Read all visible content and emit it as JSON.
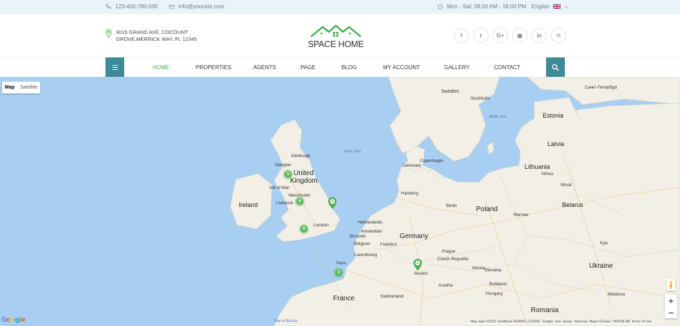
{
  "topbar": {
    "phone": "123-456-789-000",
    "email": "info@yoursite.com",
    "hours": "Mon - Sat: 08.00 AM - 18.00 PM",
    "language": "English"
  },
  "header": {
    "address_line1": "3015 GRAND AVE, COCOUNT",
    "address_line2": "GROVE,MERRICK WAY, FL 12345",
    "logo_text": "SPACE HOME",
    "socials": [
      {
        "icon": "facebook-icon",
        "glyph": "f"
      },
      {
        "icon": "twitter-icon",
        "glyph": "t"
      },
      {
        "icon": "google-plus-icon",
        "glyph": "G+"
      },
      {
        "icon": "flickr-icon",
        "glyph": "▣"
      },
      {
        "icon": "linkedin-icon",
        "glyph": "in"
      },
      {
        "icon": "pinterest-icon",
        "glyph": "℗"
      }
    ]
  },
  "nav": {
    "items": [
      {
        "label": "HOME",
        "active": true
      },
      {
        "label": "PROPERTIES",
        "active": false
      },
      {
        "label": "AGENTS",
        "active": false
      },
      {
        "label": "PAGE",
        "active": false
      },
      {
        "label": "BLOG",
        "active": false
      },
      {
        "label": "MY ACCOUNT",
        "active": false
      },
      {
        "label": "GALLERY",
        "active": false
      },
      {
        "label": "CONTACT",
        "active": false
      }
    ]
  },
  "map": {
    "type_map": "Map",
    "type_satellite": "Satellite",
    "clusters": [
      {
        "count": "5"
      },
      {
        "count": "6"
      },
      {
        "count": "6"
      },
      {
        "count": "2"
      }
    ],
    "labels": {
      "sweden": "Sweden",
      "stockholm": "Stockholm",
      "estonia": "Estonia",
      "latvia": "Latvia",
      "lithuania": "Lithuania",
      "vilnius": "Vilnius",
      "denmark": "Denmark",
      "copenhagen": "Copenhagen",
      "edinburgh": "Edinburgh",
      "glasgow": "Glasgow",
      "united_kingdom_1": "United",
      "united_kingdom_2": "Kingdom",
      "isle_of_man": "Isle of Man",
      "ireland": "Ireland",
      "manchester": "Manchester",
      "liverpool": "Liverpool",
      "london": "London",
      "hamburg": "Hamburg",
      "berlin": "Berlin",
      "poland": "Poland",
      "warsaw": "Warsaw",
      "belarus": "Belarus",
      "minsk": "Minsk",
      "netherlands": "Netherlands",
      "amsterdam": "Amsterdam",
      "belgium": "Belgium",
      "brussels": "Brussels",
      "luxembourg": "Luxembourg",
      "germany": "Germany",
      "frankfurt": "Frankfurt",
      "prague": "Prague",
      "czech_republic": "Czech Republic",
      "paris": "Paris",
      "france": "France",
      "munich": "Munich",
      "vienna": "Vienna",
      "austria": "Austria",
      "slovakia": "Slovakia",
      "switzerland": "Switzerland",
      "hungary": "Hungary",
      "budapest": "Budapest",
      "ukraine": "Ukraine",
      "kyiv": "Kyiv",
      "moldova": "Moldova",
      "romania": "Romania",
      "north_sea": "North Sea",
      "baltic_sea": "Baltic Sea",
      "bay_of_biscay": "Bay of Biscay",
      "st_petersburg": "Санкт-Петербург"
    },
    "attribution": "Map data ©2016 GeoBasis-DE/BKG (©2009), Google, Inst. Geogr. Nacional, Mapa GISrael, ORION-ME   Terms of Use",
    "google_logo": "Google"
  },
  "colors": {
    "accent": "#3d8a98",
    "active_nav": "#4caf50",
    "topbar_bg": "#e8f4f8",
    "water": "#a8cff2",
    "land": "#f2efe6",
    "cluster": "#5bb85b"
  }
}
